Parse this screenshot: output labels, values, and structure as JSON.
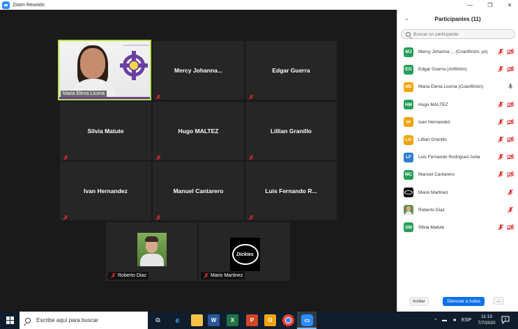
{
  "window": {
    "title": "Zoom Reunión",
    "minimize": "—",
    "restore": "❐",
    "close": "✕"
  },
  "gallery": {
    "speaker": {
      "name": "Maria Elena Licona"
    },
    "tiles": [
      {
        "name": "Mercy  Johanna..."
      },
      {
        "name": "Edgar Guerra"
      },
      {
        "name": "Silvia Matute"
      },
      {
        "name": "Hugo MALTEZ"
      },
      {
        "name": "Lillian Granillo"
      },
      {
        "name": "Ivan Hernandez"
      },
      {
        "name": "Manuel Cantarero"
      },
      {
        "name": "Luis  Fernando  R..."
      }
    ],
    "video_tiles": [
      {
        "name": "Roberto Diaz"
      },
      {
        "name": "Mario Martinez",
        "logo_text": "Dickies"
      }
    ]
  },
  "panel": {
    "title": "Participantes (11)",
    "search_placeholder": "Buscar un participante",
    "participants": [
      {
        "initials": "MJ",
        "name": "Mercy Johanna ... (Coanfitrión, yo)",
        "color": "#27a05b",
        "mic": "muted",
        "video": "off"
      },
      {
        "initials": "EG",
        "name": "Edgar Guerra (Anfitrión)",
        "color": "#27a05b",
        "mic": "muted",
        "video": "off"
      },
      {
        "initials": "ME",
        "name": "Maria Elena Licona (Coanfitrión)",
        "color": "#f0a30a",
        "mic": "on",
        "video": "on"
      },
      {
        "initials": "HM",
        "name": "Hugo MALTEZ",
        "color": "#27a05b",
        "mic": "muted",
        "video": "off"
      },
      {
        "initials": "IH",
        "name": "Ivan Hernandez",
        "color": "#f0a30a",
        "mic": "muted",
        "video": "off"
      },
      {
        "initials": "LG",
        "name": "Lillian Granillo",
        "color": "#f0a30a",
        "mic": "muted",
        "video": "off"
      },
      {
        "initials": "LF",
        "name": "Luis Fernando Rodriguez Avila",
        "color": "#2d7dd2",
        "mic": "muted",
        "video": "off"
      },
      {
        "initials": "MC",
        "name": "Manuel Cantarero",
        "color": "#27a05b",
        "mic": "muted",
        "video": "off"
      },
      {
        "initials": "",
        "name": "Mario Martinez",
        "color": "#000000",
        "mic": "muted",
        "video": "on"
      },
      {
        "initials": "",
        "name": "Roberto Diaz",
        "color": "#6b8e4e",
        "mic": "muted",
        "video": "on"
      },
      {
        "initials": "SM",
        "name": "Silvia Matute",
        "color": "#27a05b",
        "mic": "muted",
        "video": "off"
      }
    ],
    "invite_label": "Invitar",
    "mute_all_label": "Silenciar a todos",
    "more_label": "..."
  },
  "taskbar": {
    "search_placeholder": "Escribe aquí para buscar",
    "apps": [
      "task-view",
      "edge",
      "file-explorer",
      "word",
      "excel",
      "powerpoint",
      "outlook",
      "chrome",
      "zoom"
    ],
    "language": "ESP",
    "time": "11:13",
    "date": "7/7/2020",
    "notifications": "2"
  },
  "colors": {
    "accent": "#0e72ed",
    "speaker_border": "#b8e04a",
    "muted_red": "#e02828"
  }
}
